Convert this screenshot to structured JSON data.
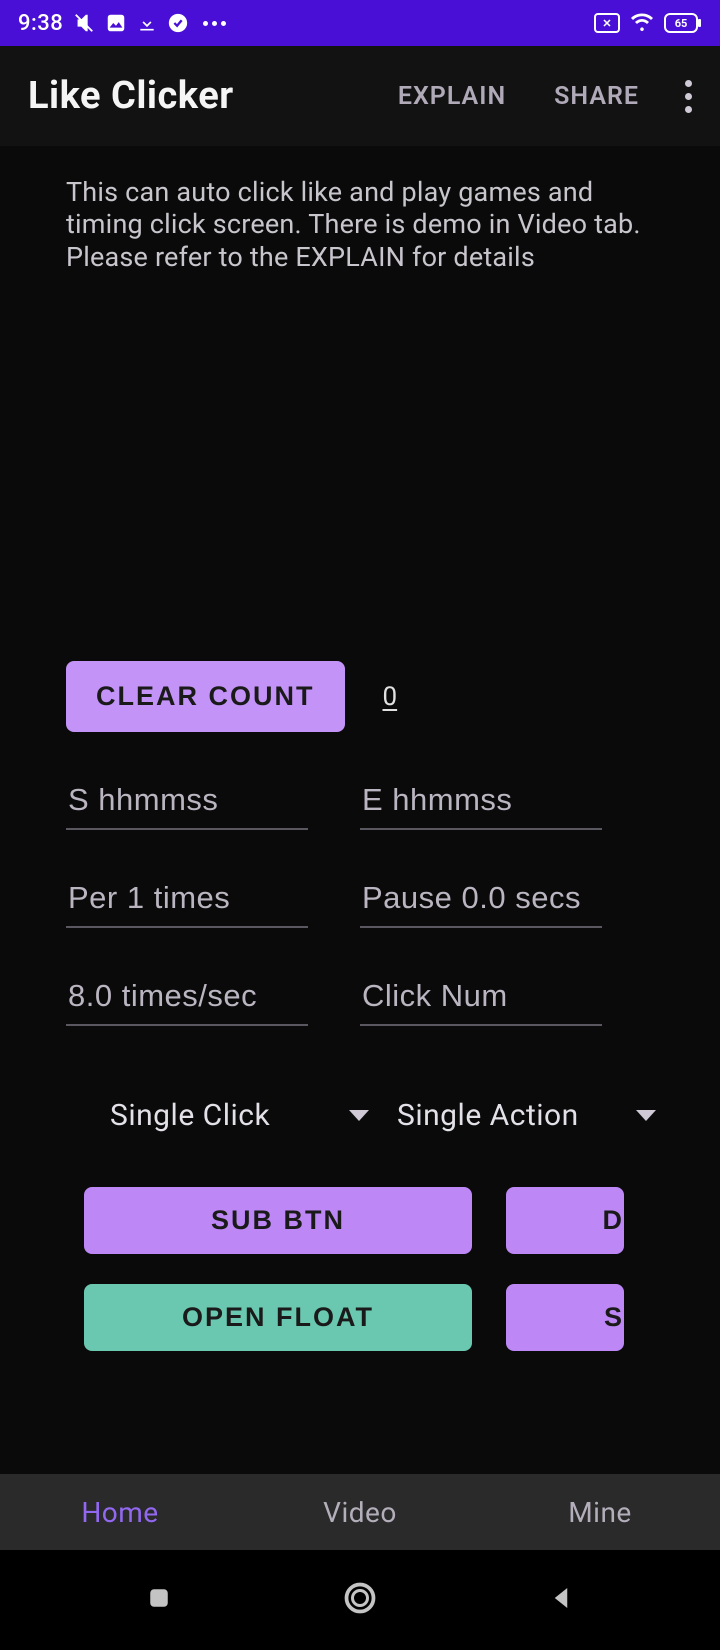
{
  "status": {
    "time": "9:38",
    "battery": "65"
  },
  "appbar": {
    "title": "Like Clicker",
    "explain": "EXPLAIN",
    "share": "SHARE"
  },
  "description": "This can auto click like and play games and timing click screen. There is demo in Video tab. Please refer to the EXPLAIN for details",
  "clear_count_label": "CLEAR COUNT",
  "count_value": "0",
  "inputs": {
    "start": "S hhmmss",
    "end": "E hhmmss",
    "per": "Per 1 times",
    "pause": "Pause 0.0 secs",
    "rate": "8.0 times/sec",
    "clicknum": "Click Num"
  },
  "selects": {
    "mode": "Single Click",
    "action": "Single Action"
  },
  "buttons": {
    "sub": "SUB BTN",
    "d": "D",
    "open_float": "OPEN FLOAT",
    "s": "S"
  },
  "tabs": {
    "home": "Home",
    "video": "Video",
    "mine": "Mine"
  }
}
